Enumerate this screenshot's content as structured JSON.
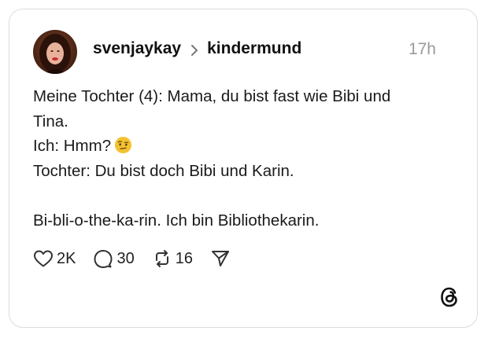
{
  "post": {
    "author": "svenjaykay",
    "community": "kindermund",
    "timestamp": "17h",
    "lines": [
      "Meine Tochter (4): Mama, du bist fast wie Bibi und",
      "Tina.",
      "Ich: Hmm?",
      "Tochter: Du bist doch Bibi und Karin.",
      "",
      "Bi-bli-o-the-ka-rin. Ich bin Bibliothekarin."
    ],
    "emoji": "face-with-raised-eyebrow"
  },
  "actions": {
    "likes": "2K",
    "replies": "30",
    "reposts": "16"
  },
  "colors": {
    "text": "#1a1a1a",
    "muted": "#9a9a9a",
    "border": "#dcdcdc",
    "emoji": "#f4c130"
  },
  "icons": [
    "heart-icon",
    "comment-icon",
    "repost-icon",
    "share-icon",
    "threads-logo-icon",
    "chevron-right-icon"
  ]
}
